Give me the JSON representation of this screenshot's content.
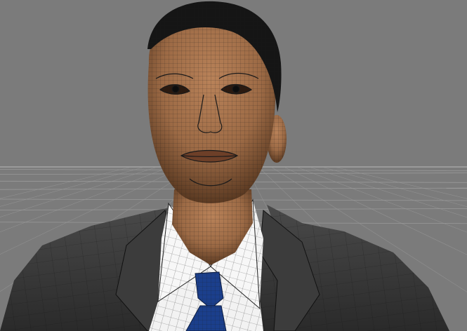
{
  "viewport": {
    "background_color": "#7b7b7b",
    "grid_color": "#9a9a9a",
    "wireframe_color": "#1a1a1a",
    "shading": "wireframe-on-shaded",
    "view": "perspective"
  },
  "model": {
    "skin_color": "#9c6a45",
    "hair_color": "#151515",
    "suit_color": "#343434",
    "shirt_color": "#f2f2f2",
    "tie_color": "#1b3f8c"
  }
}
